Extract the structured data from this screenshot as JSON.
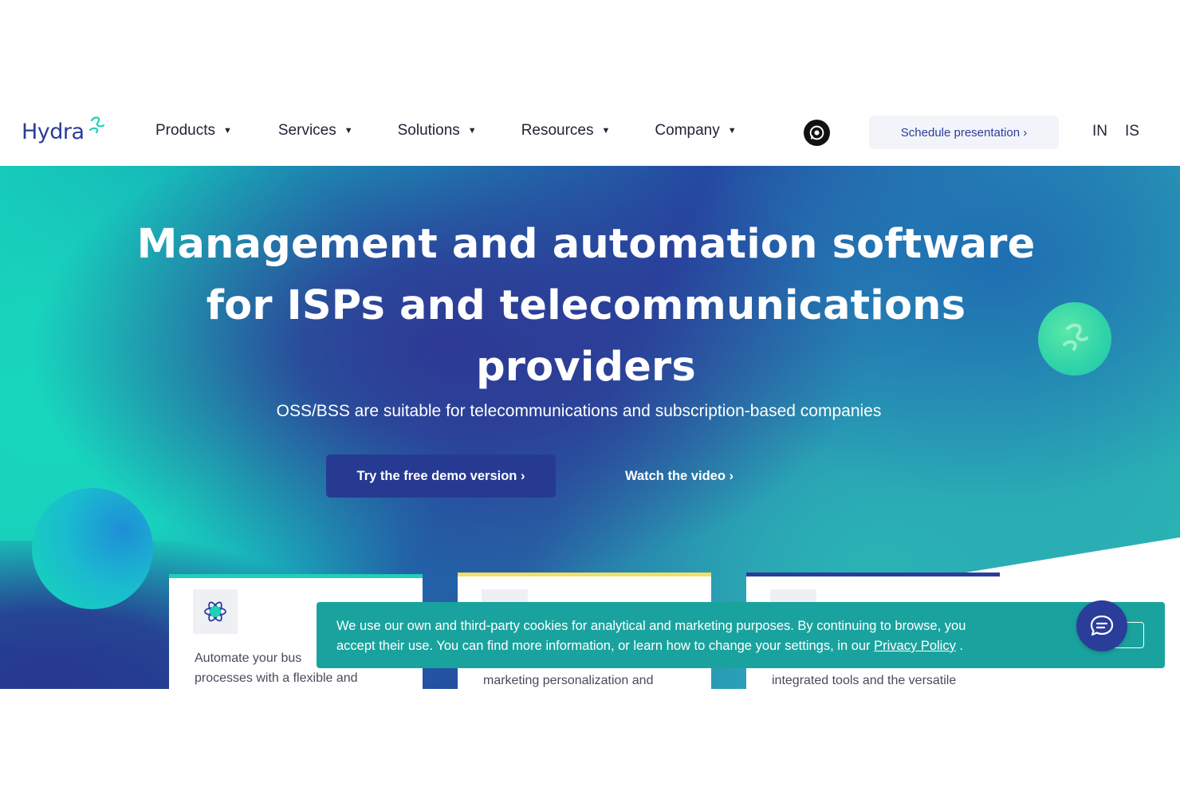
{
  "brand": {
    "name": "Hydra",
    "primary_color": "#2b3d9a",
    "accent_color": "#1fd0b8"
  },
  "nav": {
    "items": [
      {
        "label": "Products"
      },
      {
        "label": "Services"
      },
      {
        "label": "Solutions"
      },
      {
        "label": "Resources"
      },
      {
        "label": "Company"
      }
    ],
    "whatsapp_icon": "whatsapp-icon",
    "schedule_label": "Schedule presentation ›",
    "languages": [
      "IN",
      "IS"
    ]
  },
  "hero": {
    "title_lines": [
      "Management and automation software",
      "for ISPs and telecommunications",
      "providers"
    ],
    "subtitle": "OSS/BSS are suitable for telecommunications and subscription-based companies",
    "demo_label": "Try the free demo version ›",
    "video_label": "Watch the video ›"
  },
  "cards": [
    {
      "accent": "#1fd0b8",
      "icon": "atom-icon",
      "text_lines": [
        "Automate your bus",
        "processes with a flexible and"
      ]
    },
    {
      "accent": "#f0e067",
      "icon": "placeholder-icon",
      "text_lines": [
        "marketing personalization and"
      ]
    },
    {
      "accent": "#2b3d9a",
      "icon": "placeholder-icon",
      "text_lines": [
        "integrated tools and the versatile"
      ]
    }
  ],
  "cookie": {
    "text_line1": "We use our own and third-party cookies for analytical and marketing purposes. By continuing to browse, you",
    "text_line2_prefix": "accept their use. You can find more information, or learn how to change your settings, in our ",
    "link_label": "Privacy Policy",
    "text_line2_suffix": " .",
    "background": "#1aa39e"
  },
  "chat": {
    "icon": "chat-bubble-icon"
  }
}
